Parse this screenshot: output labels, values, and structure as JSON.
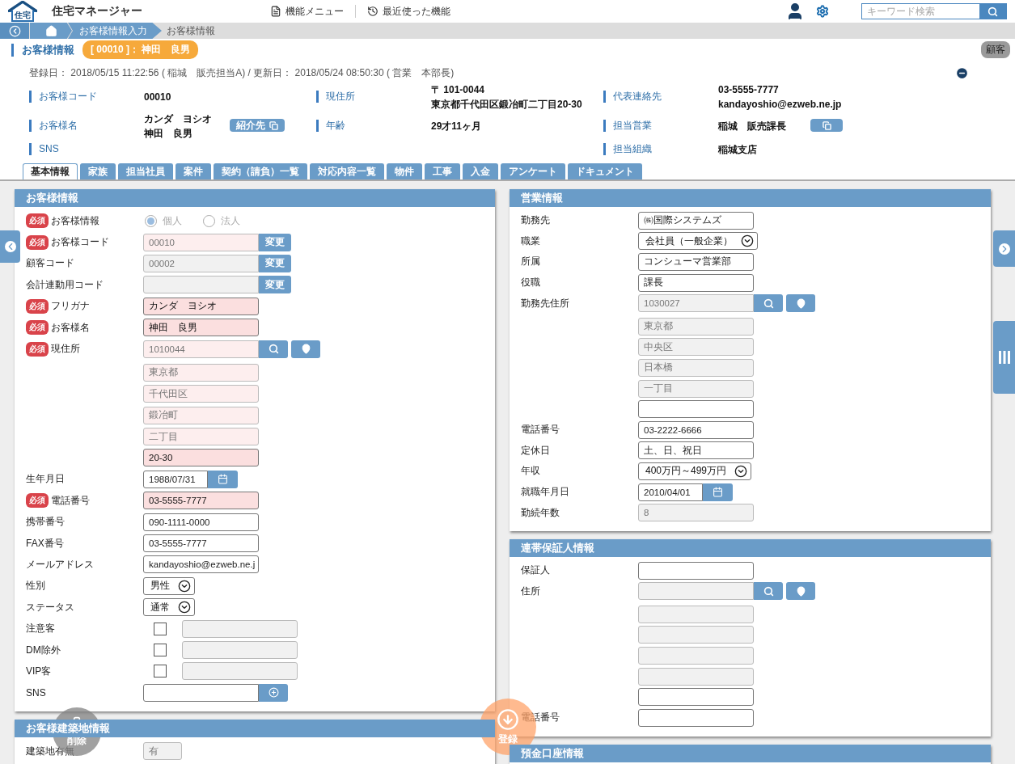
{
  "header": {
    "logo_text": "住宅",
    "app_title": "住宅マネージャー",
    "menu": [
      {
        "kind": "menu",
        "label": "機能メニュー"
      },
      {
        "kind": "recent",
        "label": "最近使った機能"
      }
    ],
    "search": {
      "placeholder": "キーワード検索"
    }
  },
  "breadcrumb": [
    {
      "label": "お客様情報入力",
      "current": false
    },
    {
      "label": "お客様情報",
      "current": true
    }
  ],
  "page_title": {
    "title": "お客様情報",
    "record": "[ 00010 ]： 神田　良男",
    "type_badge": "顧客"
  },
  "meta": "登録日： 2018/05/15 11:22:56 ( 稲城　販売担当A) / 更新日： 2018/05/24 08:50:30 ( 営業　本部長)",
  "info_columns": [
    [
      {
        "kind": "plain",
        "label": "お客様コード",
        "values": [
          "00010"
        ]
      },
      {
        "kind": "button",
        "label": "お客様名",
        "values": [
          "カンダ　ヨシオ",
          "神田　良男"
        ],
        "button": "紹介先"
      },
      {
        "kind": "plain",
        "label": "SNS"
      }
    ],
    [
      {
        "kind": "plain",
        "label": "現住所",
        "values": [
          "〒 101-0044",
          "東京都千代田区鍛冶町二丁目20-30"
        ]
      },
      {
        "kind": "plain",
        "label": "年齢",
        "values": [
          "29才11ヶ月"
        ]
      }
    ],
    [
      {
        "kind": "plain",
        "label": "代表連絡先",
        "values": [
          "03-5555-7777",
          "kandayoshio@ezweb.ne.jp"
        ]
      },
      {
        "kind": "icon_button",
        "label": "担当営業",
        "values": [
          "稲城　販売課長"
        ]
      },
      {
        "kind": "plain",
        "label": "担当組織",
        "values": [
          "稲城支店"
        ]
      }
    ]
  ],
  "tabs": [
    {
      "label": "基本情報",
      "selected": true
    },
    {
      "label": "家族",
      "selected": false
    },
    {
      "label": "担当社員",
      "selected": false
    },
    {
      "label": "案件",
      "selected": false
    },
    {
      "label": "契約（請負）一覧",
      "selected": false
    },
    {
      "label": "対応内容一覧",
      "selected": false
    },
    {
      "label": "物件",
      "selected": false
    },
    {
      "label": "工事",
      "selected": false
    },
    {
      "label": "入金",
      "selected": false
    },
    {
      "label": "アンケート",
      "selected": false
    },
    {
      "label": "ドキュメント",
      "selected": false
    }
  ],
  "columns": [
    [
      {
        "title": "お客様情報",
        "rows": [
          {
            "kind": "radio",
            "badge": "必須",
            "label": "お客様情報",
            "disabled": true,
            "options": [
              {
                "label": "個人",
                "selected": true
              },
              {
                "label": "法人",
                "selected": false
              }
            ]
          },
          {
            "kind": "code",
            "badge": "必須",
            "label": "お客様コード",
            "value": "00010",
            "required": true,
            "readonly": true,
            "button": "変更"
          },
          {
            "kind": "code",
            "label": "顧客コード",
            "value": "00002",
            "required": false,
            "readonly": true,
            "button": "変更"
          },
          {
            "kind": "code",
            "label": "会計連動用コード",
            "required": false,
            "readonly": true,
            "button": "変更"
          },
          {
            "kind": "text",
            "badge": "必須",
            "label": "フリガナ",
            "value": "カンダ　ヨシオ",
            "required": true,
            "readonly": false
          },
          {
            "kind": "text",
            "badge": "必須",
            "label": "お客様名",
            "value": "神田　良男",
            "required": true,
            "readonly": false
          },
          {
            "kind": "address",
            "badge": "必須",
            "label": "現住所",
            "value": "1010044",
            "required": true,
            "readonly": true
          },
          {
            "kind": "line",
            "value": "東京都",
            "required": true,
            "readonly": true
          },
          {
            "kind": "line",
            "value": "千代田区",
            "required": true,
            "readonly": true
          },
          {
            "kind": "line",
            "value": "鍛冶町",
            "required": true,
            "readonly": true
          },
          {
            "kind": "line",
            "value": "二丁目",
            "required": true,
            "readonly": true
          },
          {
            "kind": "line",
            "value": "20-30",
            "required": true,
            "readonly": false
          },
          {
            "kind": "date",
            "label": "生年月日",
            "value": "1988/07/31",
            "required": false,
            "readonly": false
          },
          {
            "kind": "text",
            "badge": "必須",
            "label": "電話番号",
            "value": "03-5555-7777",
            "required": true,
            "readonly": false
          },
          {
            "kind": "text",
            "label": "携帯番号",
            "value": "090-1111-0000",
            "required": false,
            "readonly": false
          },
          {
            "kind": "text",
            "label": "FAX番号",
            "value": "03-5555-7777",
            "required": false,
            "readonly": false
          },
          {
            "kind": "text",
            "label": "メールアドレス",
            "value": "kandayoshio@ezweb.ne.j",
            "required": false,
            "readonly": false
          },
          {
            "kind": "select",
            "label": "性別",
            "value": "男性"
          },
          {
            "kind": "select",
            "label": "ステータス",
            "value": "通常"
          },
          {
            "kind": "check",
            "label": "注意客",
            "checked": false
          },
          {
            "kind": "check",
            "label": "DM除外",
            "checked": false
          },
          {
            "kind": "check",
            "label": "VIP客",
            "checked": false
          },
          {
            "kind": "sns",
            "label": "SNS",
            "required": false,
            "readonly": false
          }
        ]
      },
      {
        "title": "お客様建築地情報",
        "rows": [
          {
            "kind": "short",
            "label": "建築地有無",
            "value": "有",
            "required": false,
            "readonly": true
          }
        ]
      }
    ],
    [
      {
        "title": "営業情報",
        "rows": [
          {
            "kind": "text",
            "label": "勤務先",
            "value": "㈱国際システムズ",
            "required": false,
            "readonly": false
          },
          {
            "kind": "select",
            "label": "職業",
            "value": "会社員（一般企業）"
          },
          {
            "kind": "text",
            "label": "所属",
            "value": "コンシューマ営業部",
            "required": false,
            "readonly": false
          },
          {
            "kind": "text",
            "label": "役職",
            "value": "課長",
            "required": false,
            "readonly": false
          },
          {
            "kind": "address",
            "label": "勤務先住所",
            "value": "1030027",
            "required": false,
            "readonly": true
          },
          {
            "kind": "line",
            "value": "東京都",
            "required": false,
            "readonly": true
          },
          {
            "kind": "line",
            "value": "中央区",
            "required": false,
            "readonly": true
          },
          {
            "kind": "line",
            "value": "日本橋",
            "required": false,
            "readonly": true
          },
          {
            "kind": "line",
            "value": "一丁目",
            "required": false,
            "readonly": true
          },
          {
            "kind": "line",
            "required": false,
            "readonly": false
          },
          {
            "kind": "text",
            "label": "電話番号",
            "value": "03-2222-6666",
            "required": false,
            "readonly": false
          },
          {
            "kind": "text",
            "label": "定休日",
            "value": "土、日、祝日",
            "required": false,
            "readonly": false
          },
          {
            "kind": "select",
            "label": "年収",
            "value": "400万円～499万円"
          },
          {
            "kind": "date",
            "label": "就職年月日",
            "value": "2010/04/01",
            "required": false,
            "readonly": false
          },
          {
            "kind": "text",
            "label": "勤続年数",
            "value": "8",
            "required": false,
            "readonly": true
          }
        ]
      },
      {
        "title": "連帯保証人情報",
        "rows": [
          {
            "kind": "text",
            "label": "保証人",
            "required": false,
            "readonly": false
          },
          {
            "kind": "address",
            "label": "住所",
            "required": false,
            "readonly": true
          },
          {
            "kind": "line",
            "required": false,
            "readonly": true
          },
          {
            "kind": "line",
            "required": false,
            "readonly": true
          },
          {
            "kind": "line",
            "required": false,
            "readonly": true
          },
          {
            "kind": "line",
            "required": false,
            "readonly": true
          },
          {
            "kind": "line",
            "required": false,
            "readonly": false
          },
          {
            "kind": "text",
            "label": "電話番号",
            "required": false,
            "readonly": false
          }
        ]
      },
      {
        "title": "預金口座情報"
      }
    ]
  ],
  "actions": [
    {
      "kind": "delete",
      "label": "削除"
    },
    {
      "kind": "save",
      "label": "登録"
    }
  ]
}
